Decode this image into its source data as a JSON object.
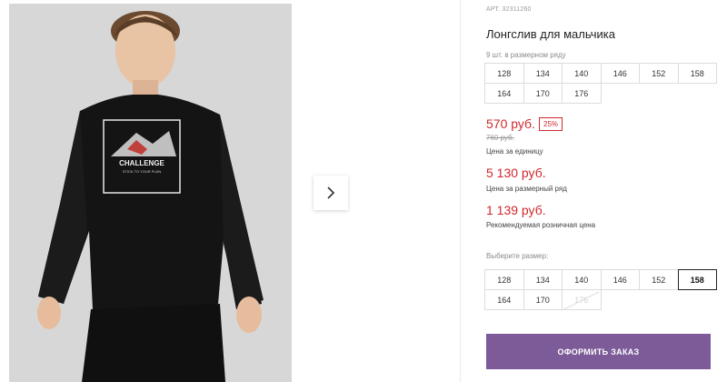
{
  "product": {
    "article_label": "АРТ. 32311260",
    "title": "Лонгслив для мальчика",
    "series_label": "9 шт. в размерном ряду",
    "series_sizes": [
      "128",
      "134",
      "140",
      "146",
      "152",
      "158",
      "164",
      "170",
      "176"
    ],
    "price_unit": "570 руб.",
    "discount": "25%",
    "old_price": "760 руб.",
    "price_unit_caption": "Цена за единицу",
    "price_series": "5 130 руб.",
    "price_series_caption": "Цена за размерный ряд",
    "price_retail": "1 139 руб.",
    "price_retail_caption": "Рекомендуемая розничная цена"
  },
  "size_picker": {
    "label": "Выберите размер:",
    "sizes": [
      "128",
      "134",
      "140",
      "146",
      "152",
      "158",
      "164",
      "170",
      "176"
    ],
    "selected": "158",
    "unavailable": [
      "176"
    ]
  },
  "print": {
    "word": "CHALLENGE",
    "subline": "STICK TO YOUR PLAN"
  },
  "order_button": "ОФОРМИТЬ ЗАКАЗ",
  "colors": {
    "accent": "#7c5b98",
    "price_red": "#d0282d",
    "photo_bg": "#d7d7d7"
  },
  "icons": {
    "next": "chevron-right-icon"
  }
}
